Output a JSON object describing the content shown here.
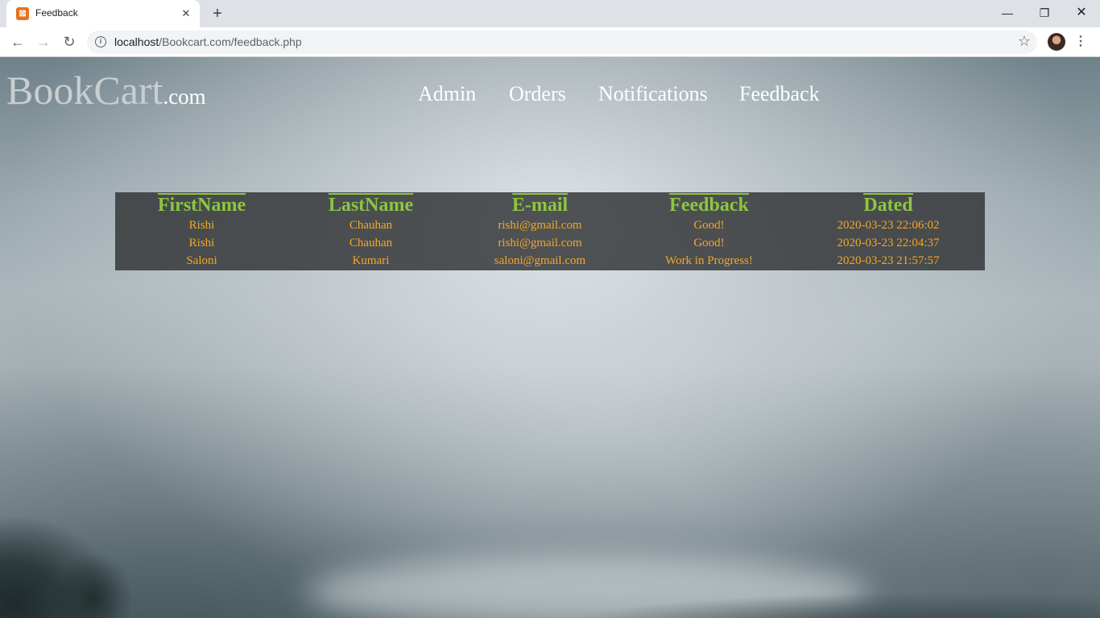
{
  "browser": {
    "tab_title": "Feedback",
    "tab_favicon": "xampp-icon",
    "new_tab_symbol": "+",
    "url_host": "localhost",
    "url_path": "/Bookcart.com/feedback.php"
  },
  "site": {
    "logo_main": "BookCart",
    "logo_suffix": ".com",
    "nav": [
      "Admin",
      "Orders",
      "Notifications",
      "Feedback"
    ]
  },
  "table": {
    "headers": [
      "FirstName",
      "LastName",
      "E-mail",
      "Feedback",
      "Dated"
    ],
    "rows": [
      [
        "Rishi",
        "Chauhan",
        "rishi@gmail.com",
        "Good!",
        "2020-03-23 22:06:02"
      ],
      [
        "Rishi",
        "Chauhan",
        "rishi@gmail.com",
        "Good!",
        "2020-03-23 22:04:37"
      ],
      [
        "Saloni",
        "Kumari",
        "saloni@gmail.com",
        "Work in Progress!",
        "2020-03-23 21:57:57"
      ]
    ]
  },
  "colors": {
    "header_text": "#8dc63f",
    "cell_text": "#f5a623",
    "table_bg": "#303235"
  }
}
